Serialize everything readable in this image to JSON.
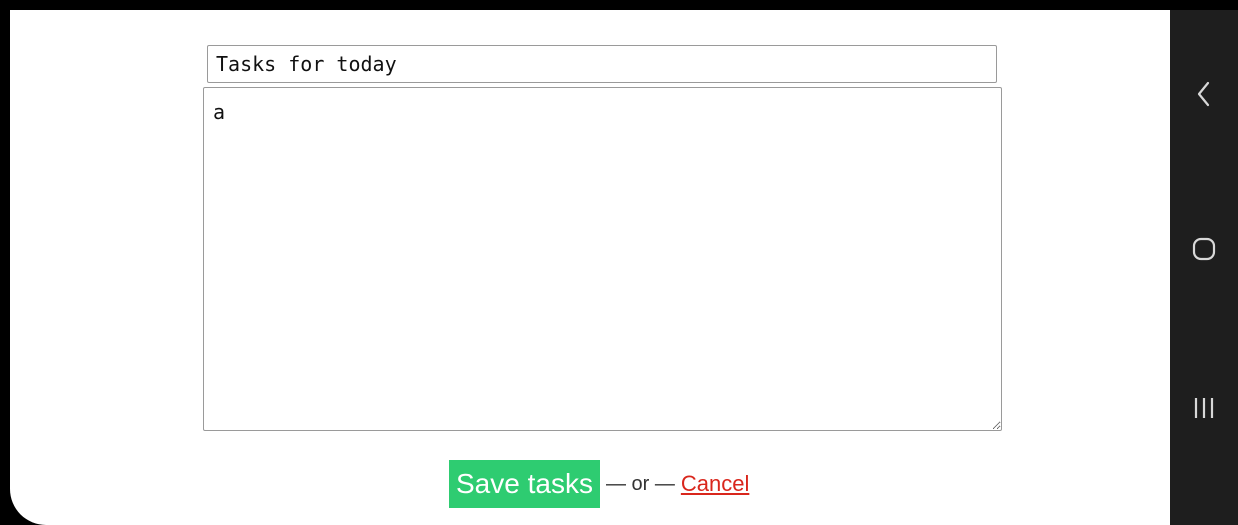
{
  "form": {
    "title_value": "Tasks for today",
    "tasks_value": "a"
  },
  "actions": {
    "save_label": "Save tasks",
    "separator_left": "— or —",
    "cancel_label": "Cancel"
  },
  "navbar": {
    "icons": [
      "back-icon",
      "home-icon",
      "recents-icon"
    ]
  },
  "colors": {
    "save_button": "#2ecc71",
    "cancel_link": "#d9261c",
    "navbar": "#1e1e1e"
  }
}
